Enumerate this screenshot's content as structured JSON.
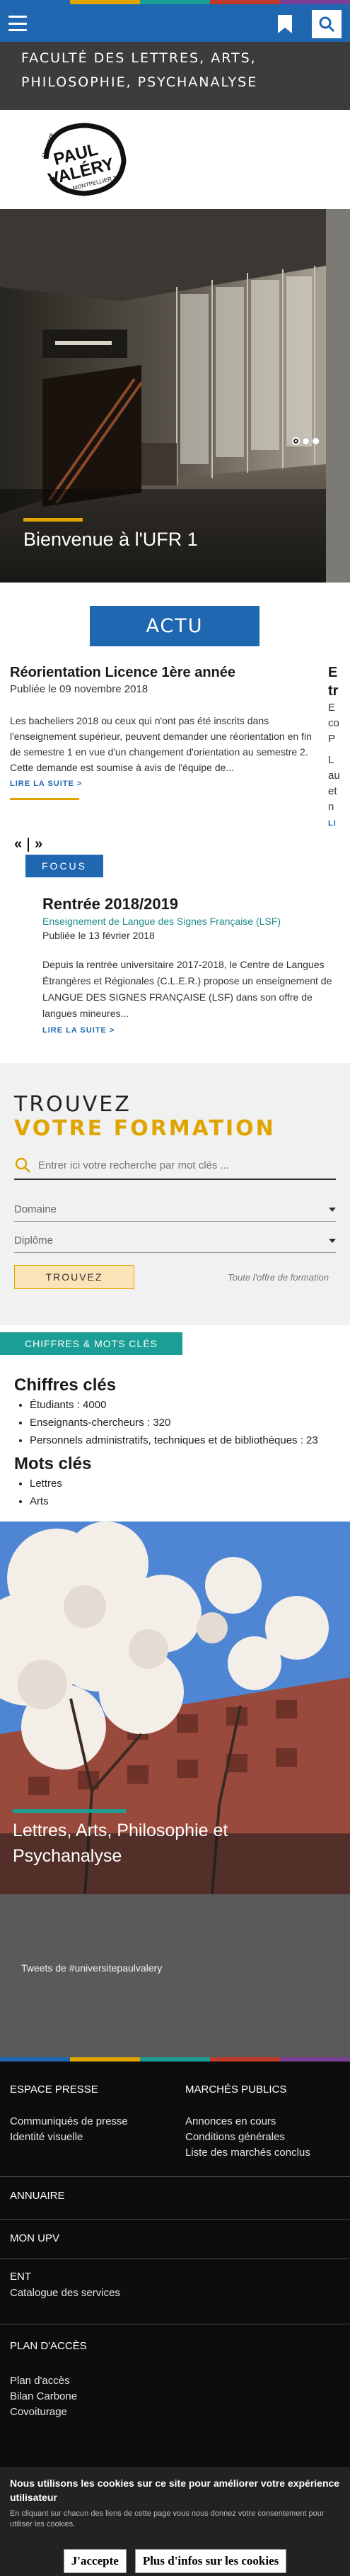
{
  "colors": {
    "brand_blue": "#1f67b1",
    "accent_yellow": "#e0a400",
    "teal": "#1b9e96",
    "dark_band": "#3c3c3c",
    "top_stripe": [
      "#1f67b1",
      "#e0a400",
      "#1b9e96",
      "#c0392b",
      "#7b3f98"
    ]
  },
  "header": {
    "menu_icon": "hamburger-menu-icon",
    "bookmark_icon": "bookmark-icon",
    "search_icon": "search-icon",
    "faculty_title": "Faculté des lettres, arts, philosophie, psychanalyse",
    "logo_text": {
      "line1": "Université",
      "line2": "PAUL",
      "line3": "VALÉRY",
      "line4": "MONTPELLIER 3"
    }
  },
  "hero": {
    "caption": "Bienvenue à l'UFR 1",
    "slide_count": 3,
    "active_slide": 1
  },
  "actu": {
    "button_label": "ACTU",
    "items": [
      {
        "title": "Réorientation Licence 1ère année",
        "date": "Publiée le 09 novembre 2018",
        "excerpt": "Les bacheliers 2018 ou ceux qui n'ont pas été inscrits  dans l'enseignement supérieur, peuvent demander une réorientation en fin de semestre 1 en vue d'un changement d'orientation au semestre 2. Cette demande est soumise à avis de l'équipe de...",
        "read_more": "LIRE LA SUITE  >"
      },
      {
        "title": "E",
        "title2": "tr",
        "subtitle": "E",
        "subtitle2": "co",
        "date": "P",
        "excerpt_lines": [
          "L",
          "au",
          "et",
          "n"
        ],
        "read_more": "LI"
      }
    ],
    "pager": {
      "prev": "«",
      "next": "»"
    }
  },
  "focus": {
    "tag": "FOCUS",
    "title": "Rentrée 2018/2019",
    "subtitle": "Enseignement de Langue des Signes Française (LSF)",
    "date": "Publiée le 13 février 2018",
    "excerpt": "Depuis la rentrée universitaire 2017-2018, le Centre de Langues Étrangères et Régionales (C.L.E.R.) propose un enseignement de LANGUE DES SIGNES FRANÇAISE (LSF) dans son offre de langues mineures...",
    "read_more": "LIRE LA SUITE  >"
  },
  "formation": {
    "title_line1": "TROUVEZ",
    "title_line2": "VOTRE FORMATION",
    "search_placeholder": "Entrer ici votre recherche par mot clés ...",
    "domain_select": "Domaine",
    "diploma_select": "Diplôme",
    "find_button": "TROUVEZ",
    "all_offer_link": "Toute l'offre de formation"
  },
  "chiffres": {
    "tag": "CHIFFRES & MOTS CLÉS",
    "figures_title": "Chiffres clés",
    "figures": [
      "Étudiants : 4000",
      "Enseignants-chercheurs : 320",
      "Personnels administratifs, techniques et de bibliothèques : 23"
    ],
    "keywords_title": "Mots clés",
    "keywords": [
      "Lettres",
      "Arts"
    ]
  },
  "photo2": {
    "caption": "Lettres, Arts, Philosophie et Psychanalyse"
  },
  "tweets": {
    "text": "Tweets de #universitepaulvalery"
  },
  "footer": {
    "espace_presse": {
      "title": "ESPACE PRESSE",
      "links": [
        "Communiqués de presse",
        "Identité visuelle"
      ]
    },
    "marches": {
      "title": "MARCHÉS PUBLICS",
      "links": [
        "Annonces en cours",
        "Conditions générales",
        "Liste des marchés conclus"
      ]
    },
    "annuaire": "ANNUAIRE",
    "mon_upv": "MON UPV",
    "ent": "ENT",
    "catalogue": "Catalogue des services",
    "plan_acces": {
      "title": "PLAN D'ACCÈS",
      "links": [
        "Plan d'accès",
        "Bilan Carbone",
        "Covoiturage"
      ]
    }
  },
  "cookie": {
    "title": "Nous utilisons les cookies sur ce site pour améliorer votre expérience utilisateur",
    "small": "En cliquant sur chacun des liens de cette page vous nous donnez votre consentement pour utiliser les cookies.",
    "accept": "J'accepte",
    "more": "Plus d'infos sur les cookies"
  }
}
